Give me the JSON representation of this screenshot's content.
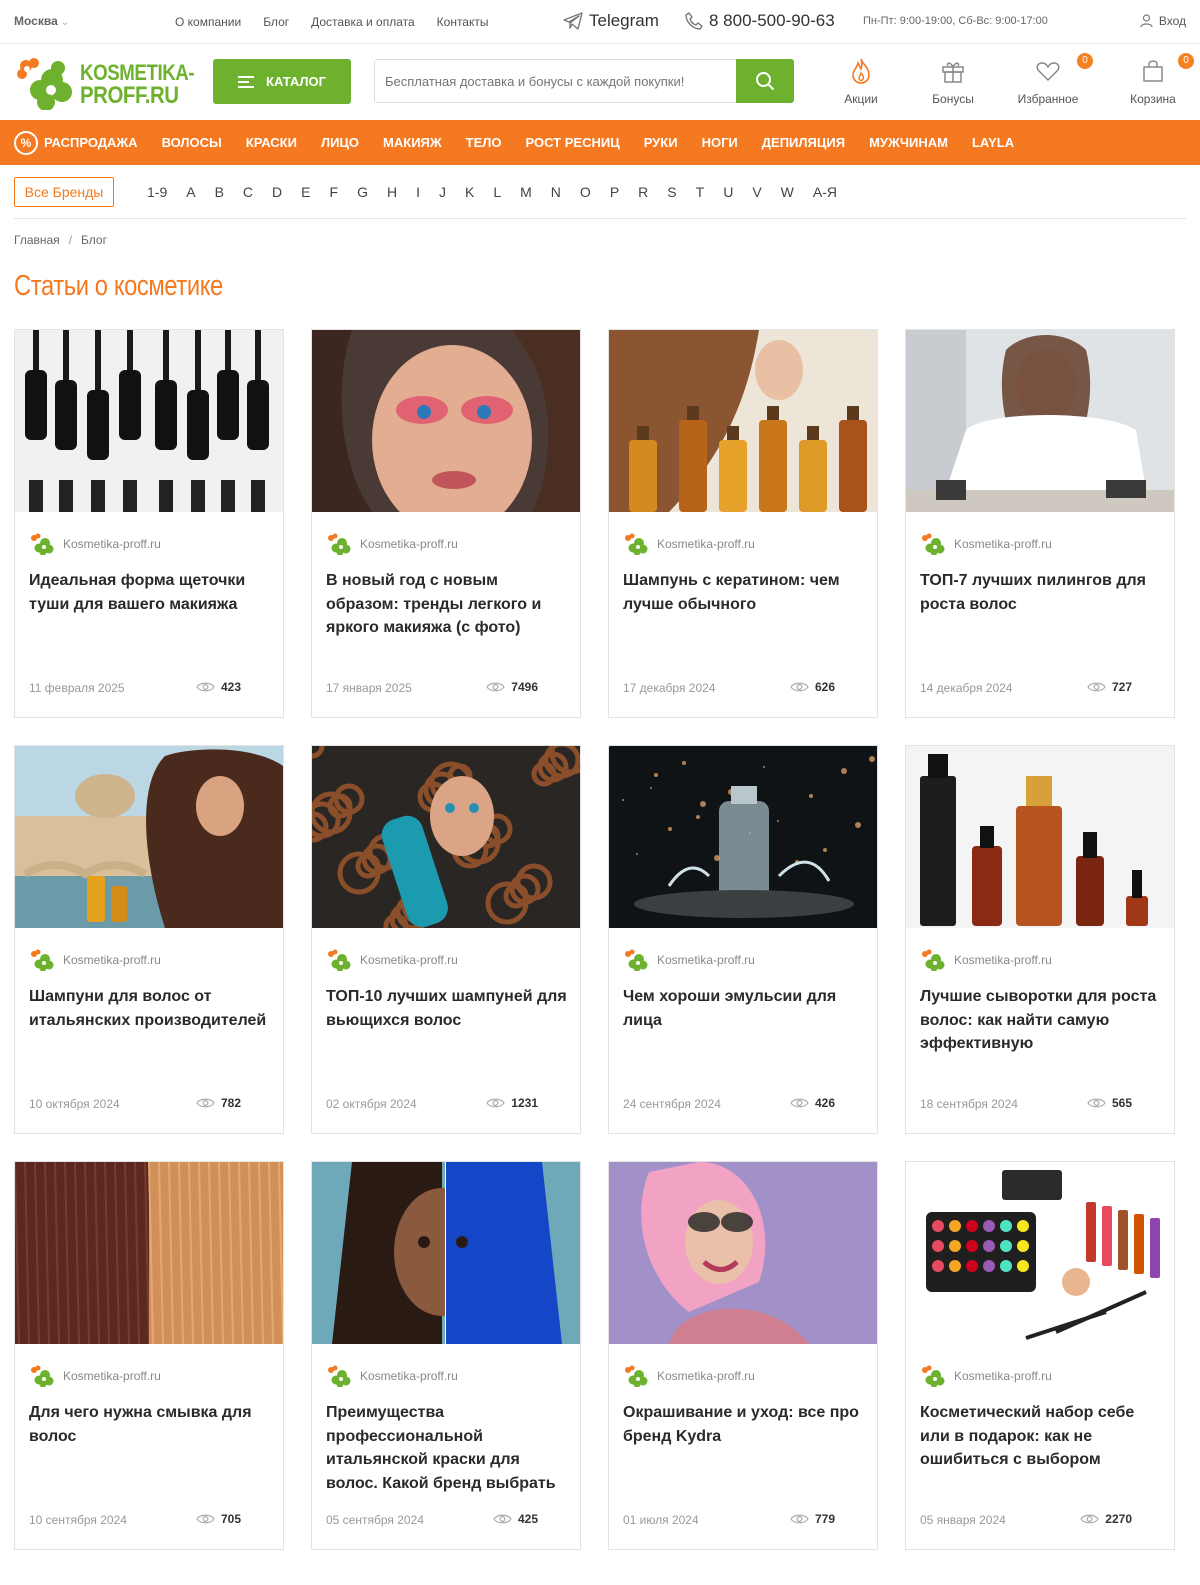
{
  "topbar": {
    "city": "Москва",
    "links": [
      "О компании",
      "Блог",
      "Доставка и оплата",
      "Контакты"
    ],
    "telegram": "Telegram",
    "phone": "8 800-500-90-63",
    "hours": "Пн-Пт: 9:00-19:00, Сб-Вс: 9:00-17:00",
    "login": "Вход"
  },
  "header": {
    "logo_line1": "KOSMETIKA-",
    "logo_line2": "PROFF.RU",
    "catalog": "КАТАЛОГ",
    "search_placeholder": "Бесплатная доставка и бонусы с каждой покупки!",
    "promo": "Акции",
    "bonus": "Бонусы",
    "favorites": "Избранное",
    "favorites_count": "0",
    "cart": "Корзина",
    "cart_count": "0"
  },
  "nav": [
    "РАСПРОДАЖА",
    "ВОЛОСЫ",
    "КРАСКИ",
    "ЛИЦО",
    "МАКИЯЖ",
    "ТЕЛО",
    "РОСТ РЕСНИЦ",
    "РУКИ",
    "НОГИ",
    "ДЕПИЛЯЦИЯ",
    "МУЖЧИНАМ",
    "LAYLA"
  ],
  "brands": {
    "all": "Все Бренды",
    "letters": [
      "1-9",
      "A",
      "B",
      "C",
      "D",
      "E",
      "F",
      "G",
      "H",
      "I",
      "J",
      "K",
      "L",
      "M",
      "N",
      "O",
      "P",
      "R",
      "S",
      "T",
      "U",
      "V",
      "W",
      "А-Я"
    ]
  },
  "breadcrumbs": [
    "Главная",
    "Блог"
  ],
  "page_title": "Статьи о косметике",
  "articles": [
    {
      "source": "Kosmetika-proff.ru",
      "title": "Идеальная форма щеточки туши для вашего макияжа",
      "date": "11 февраля 2025",
      "views": "423",
      "image": "mascara-brushes"
    },
    {
      "source": "Kosmetika-proff.ru",
      "title": "В новый год с новым образом: тренды легкого и яркого макияжа (с фото)",
      "date": "17 января 2025",
      "views": "7496",
      "image": "bright-makeup-portrait"
    },
    {
      "source": "Kosmetika-proff.ru",
      "title": "Шампунь с кератином: чем лучше обычного",
      "date": "17 декабря 2024",
      "views": "626",
      "image": "hair-oils"
    },
    {
      "source": "Kosmetika-proff.ru",
      "title": "ТОП-7 лучших пилингов для роста волос",
      "date": "14 декабря 2024",
      "views": "727",
      "image": "towel-woman"
    },
    {
      "source": "Kosmetika-proff.ru",
      "title": "Шампуни для волос от итальянских производителей",
      "date": "10 октября 2024",
      "views": "782",
      "image": "rome-woman"
    },
    {
      "source": "Kosmetika-proff.ru",
      "title": "ТОП-10 лучших шампуней для вьющихся волос",
      "date": "02 октября 2024",
      "views": "1231",
      "image": "curly-hair-bottle"
    },
    {
      "source": "Kosmetika-proff.ru",
      "title": "Чем хороши эмульсии для лица",
      "date": "24 сентября 2024",
      "views": "426",
      "image": "emulsion-bottle"
    },
    {
      "source": "Kosmetika-proff.ru",
      "title": "Лучшие сыворотки для роста волос: как найти самую эффективную",
      "date": "18 сентября 2024",
      "views": "565",
      "image": "serum-bottles"
    },
    {
      "source": "Kosmetika-proff.ru",
      "title": "Для чего нужна смывка для волос",
      "date": "10 сентября 2024",
      "views": "705",
      "image": "hair-before-after"
    },
    {
      "source": "Kosmetika-proff.ru",
      "title": "Преимущества профессиональной итальянской краски для волос. Какой бренд выбрать",
      "date": "05 сентября 2024",
      "views": "425",
      "image": "blue-hair"
    },
    {
      "source": "Kosmetika-proff.ru",
      "title": "Окрашивание и уход: все про бренд Kydra",
      "date": "01 июля 2024",
      "views": "779",
      "image": "pink-hair"
    },
    {
      "source": "Kosmetika-proff.ru",
      "title": "Косметический набор себе или в подарок: как не ошибиться с выбором",
      "date": "05 января 2024",
      "views": "2270",
      "image": "makeup-set"
    }
  ],
  "colors": {
    "accent": "#f47920",
    "brand_green": "#6eb12f"
  }
}
